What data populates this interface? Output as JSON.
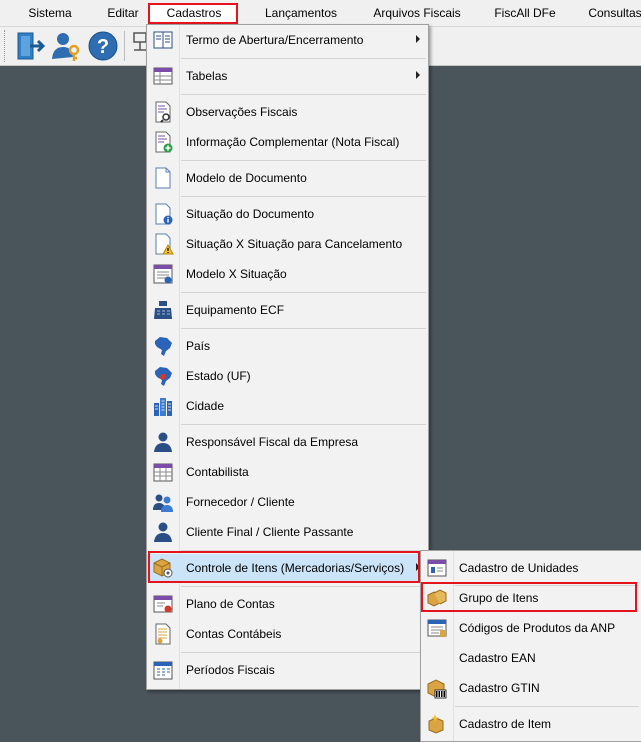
{
  "menubar": {
    "items": [
      "Sistema",
      "Editar",
      "Cadastros",
      "Lançamentos",
      "Arquivos Fiscais",
      "FiscAll DFe",
      "Consultas"
    ]
  },
  "cadastros_menu": {
    "items": [
      {
        "label": "Termo de Abertura/Encerramento",
        "icon": "book-icon",
        "submenu": true
      },
      {
        "label": "Tabelas",
        "icon": "table-icon",
        "submenu": true
      },
      {
        "label": "Observações Fiscais",
        "icon": "document-search-icon"
      },
      {
        "label": "Informação Complementar (Nota Fiscal)",
        "icon": "document-add-icon"
      },
      {
        "label": "Modelo de Documento",
        "icon": "blank-document-icon"
      },
      {
        "label": "Situação do Documento",
        "icon": "document-info-icon"
      },
      {
        "label": "Situação X Situação para Cancelamento",
        "icon": "document-warning-icon"
      },
      {
        "label": "Modelo X Situação",
        "icon": "document-list-icon"
      },
      {
        "label": "Equipamento ECF",
        "icon": "cash-register-icon"
      },
      {
        "label": "País",
        "icon": "brazil-map-icon"
      },
      {
        "label": "Estado (UF)",
        "icon": "brazil-state-map-icon"
      },
      {
        "label": "Cidade",
        "icon": "city-buildings-icon"
      },
      {
        "label": "Responsável Fiscal da Empresa",
        "icon": "user-icon"
      },
      {
        "label": "Contabilista",
        "icon": "calendar-grid-icon"
      },
      {
        "label": "Fornecedor / Cliente",
        "icon": "users-icon"
      },
      {
        "label": "Cliente Final / Cliente Passante",
        "icon": "user-icon"
      },
      {
        "label": "Controle de Itens (Mercadorias/Serviços)",
        "icon": "box-settings-icon",
        "submenu": true,
        "highlighted": true
      },
      {
        "label": "Plano de Contas",
        "icon": "accounts-plan-icon"
      },
      {
        "label": "Contas Contábeis",
        "icon": "ledger-icon"
      },
      {
        "label": "Períodos Fiscais",
        "icon": "calendar-icon"
      }
    ]
  },
  "itens_submenu": {
    "items": [
      {
        "label": "Cadastro de Unidades",
        "icon": "units-window-icon"
      },
      {
        "label": "Grupo de Itens",
        "icon": "box-group-icon",
        "highlighted": true
      },
      {
        "label": "Códigos de Produtos da ANP",
        "icon": "anp-codes-icon"
      },
      {
        "label": "Cadastro EAN",
        "icon": ""
      },
      {
        "label": "Cadastro GTIN",
        "icon": "barcode-box-icon"
      },
      {
        "label": "Cadastro de Item",
        "icon": "new-item-box-icon"
      }
    ]
  },
  "colors": {
    "menu_highlight": "#cce4f7",
    "callout_red": "#e5141c",
    "desktop": "#4a545b"
  }
}
